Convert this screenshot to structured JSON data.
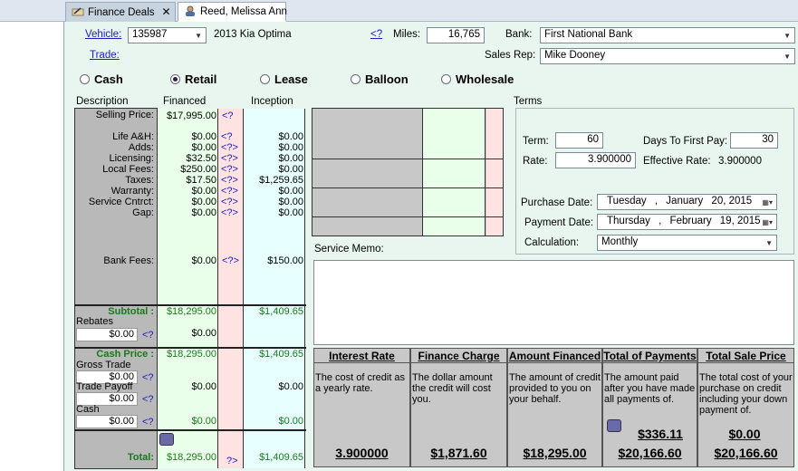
{
  "tabs": [
    {
      "label": "Finance Deals",
      "icon": "pen-icon",
      "active": false
    },
    {
      "label": "Reed, Melissa Ann",
      "icon": "customer-icon",
      "active": true
    }
  ],
  "header": {
    "vehicle_label": "Vehicle:",
    "vehicle_value": "135987",
    "vehicle_desc": "2013 Kia Optima",
    "trade_label": "Trade:",
    "help_link": "<?",
    "miles_label": "Miles:",
    "miles_value": "16,765",
    "bank_label": "Bank:",
    "bank_value": "First National Bank",
    "salesrep_label": "Sales Rep:",
    "salesrep_value": "Mike Dooney"
  },
  "deal_types": [
    {
      "label": "Cash",
      "selected": false
    },
    {
      "label": "Retail",
      "selected": true
    },
    {
      "label": "Lease",
      "selected": false
    },
    {
      "label": "Balloon",
      "selected": false
    },
    {
      "label": "Wholesale",
      "selected": false
    }
  ],
  "columns": {
    "description": "Description",
    "financed": "Financed",
    "inception": "Inception"
  },
  "lines": {
    "selling_price": {
      "label": "Selling Price:",
      "financed": "$17,995.00",
      "q": "<?"
    },
    "items": [
      {
        "label": "Life A&H:",
        "financed": "$0.00",
        "q": "<?",
        "inception": "$0.00"
      },
      {
        "label": "Adds:",
        "financed": "$0.00",
        "q": "<?>",
        "inception": "$0.00"
      },
      {
        "label": "Licensing:",
        "financed": "$32.50",
        "q": "<?>",
        "inception": "$0.00"
      },
      {
        "label": "Local Fees:",
        "financed": "$250.00",
        "q": "<?>",
        "inception": "$0.00"
      },
      {
        "label": "Taxes:",
        "financed": "$17.50",
        "q": "<?>",
        "inception": "$1,259.65"
      },
      {
        "label": "Warranty:",
        "financed": "$0.00",
        "q": "<?>",
        "inception": "$0.00"
      },
      {
        "label": "Service Cntrct:",
        "financed": "$0.00",
        "q": "<?>",
        "inception": "$0.00"
      },
      {
        "label": "Gap:",
        "financed": "$0.00",
        "q": "<?>",
        "inception": "$0.00"
      }
    ],
    "bank_fees": {
      "label": "Bank Fees:",
      "financed": "$0.00",
      "q": "<?>",
      "inception": "$150.00"
    }
  },
  "subtotal": {
    "label": "Subtotal :",
    "financed": "$18,295.00",
    "inception": "$1,409.65"
  },
  "rebates": {
    "label": "Rebates",
    "input": "$0.00",
    "q": "<?",
    "financed": "$0.00"
  },
  "cash_price": {
    "label": "Cash Price :",
    "financed": "$18,295.00",
    "inception": "$1,409.65"
  },
  "gross_trade": {
    "label": "Gross Trade",
    "input": "$0.00",
    "q": "<?"
  },
  "trade_payoff": {
    "label": "Trade Payoff",
    "input": "$0.00",
    "q": "<?",
    "financed": "$0.00",
    "inception": "$0.00"
  },
  "cash": {
    "label": "Cash",
    "input": "$0.00",
    "q": "<?",
    "financed": "$0.00",
    "inception": "$0.00"
  },
  "total": {
    "label": "Total:",
    "financed": "$18,295.00",
    "q": "?>",
    "inception": "$1,409.65"
  },
  "terms": {
    "title": "Terms",
    "term_label": "Term:",
    "term_value": "60",
    "days_label": "Days To First Pay:",
    "days_value": "30",
    "rate_label": "Rate:",
    "rate_value": "3.900000",
    "eff_label": "Effective Rate:",
    "eff_value": "3.900000",
    "purchase_label": "Purchase Date:",
    "purchase_day": "Tuesday",
    "purchase_month": "January",
    "purchase_date": "20, 2015",
    "payment_label": "Payment Date:",
    "payment_day": "Thursday",
    "payment_month": "February",
    "payment_date": "19, 2015",
    "calc_label": "Calculation:",
    "calc_value": "Monthly"
  },
  "service_memo_label": "Service Memo:",
  "summary": [
    {
      "title": "Interest Rate",
      "desc": "The cost of credit as a yearly rate.",
      "value": "3.900000"
    },
    {
      "title": "Finance Charge",
      "desc": "The dollar amount the credit will cost you.",
      "value": "$1,871.60"
    },
    {
      "title": "Amount Financed",
      "desc": "The amount of credit provided to you on your behalf.",
      "value": "$18,295.00"
    },
    {
      "title": "Total of Payments",
      "desc": "The amount paid after you have made all payments of.",
      "payment": "$336.11",
      "value": "$20,166.60"
    },
    {
      "title": "Total Sale Price",
      "desc": "The total cost of your purchase on credit including your down payment of.",
      "payment": "$0.00",
      "value": "$20,166.60"
    }
  ]
}
